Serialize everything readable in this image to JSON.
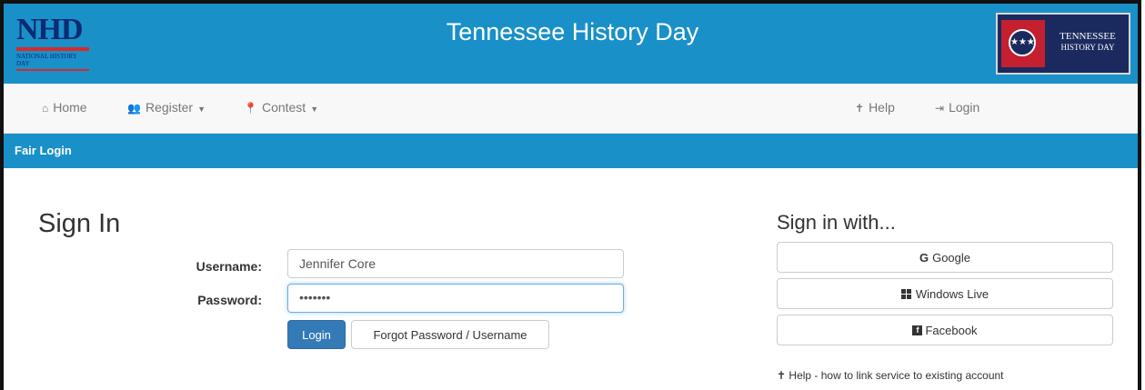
{
  "header": {
    "logo_text": "NHD",
    "logo_subtext": "NATIONAL HISTORY DAY",
    "title": "Tennessee History Day",
    "state_logo_line1": "TENNESSEE",
    "state_logo_line2": "HISTORY DAY"
  },
  "nav": {
    "home": "Home",
    "register": "Register",
    "contest": "Contest",
    "help": "Help",
    "login": "Login"
  },
  "section": {
    "title": "Fair Login"
  },
  "signin": {
    "heading": "Sign In",
    "username_label": "Username:",
    "username_value": "Jennifer Core",
    "password_label": "Password:",
    "password_value": "•••••••",
    "login_button": "Login",
    "forgot_button": "Forgot Password / Username"
  },
  "social": {
    "heading": "Sign in with...",
    "google": "Google",
    "google_icon": "G",
    "windows": "Windows Live",
    "facebook": "Facebook",
    "help_link": "Help - how to link service to existing account"
  },
  "colors": {
    "brand_blue": "#1a90c8",
    "primary_button": "#337ab7"
  }
}
